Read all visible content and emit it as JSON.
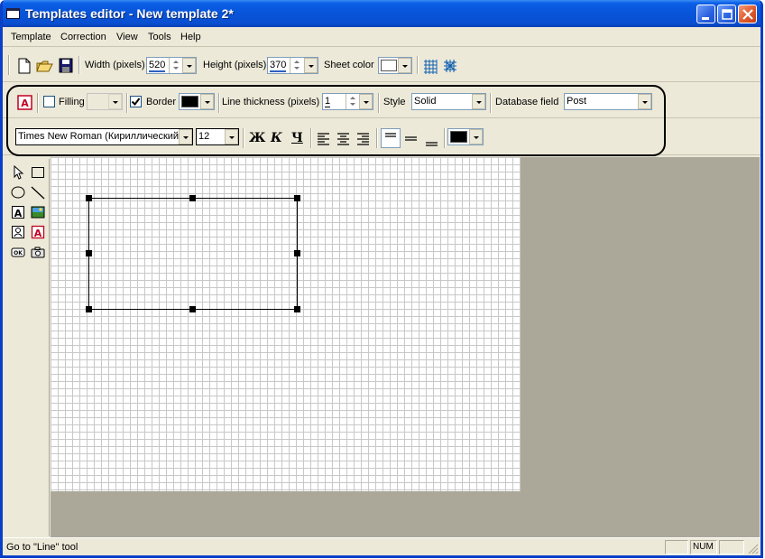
{
  "window": {
    "title": "Templates editor - New template 2*"
  },
  "menu": [
    "Template",
    "Correction",
    "View",
    "Tools",
    "Help"
  ],
  "toolbar1": {
    "width_label": "Width (pixels)",
    "width_value": "520",
    "height_label": "Height (pixels)",
    "height_value": "370",
    "sheet_color_label": "Sheet color",
    "sheet_color": "#ffffff"
  },
  "toolbar2": {
    "filling_label": "Filling",
    "filling_checked": false,
    "border_label": "Border",
    "border_checked": true,
    "border_color": "#000000",
    "line_thickness_label": "Line thickness (pixels)",
    "line_thickness_value": "1",
    "style_label": "Style",
    "style_value": "Solid",
    "db_field_label": "Database field",
    "db_field_value": "Post"
  },
  "toolbar3": {
    "font_value": "Times New Roman (Кириллический)",
    "size_value": "12",
    "bold_label": "Ж",
    "italic_label": "К",
    "underline_label": "Ч",
    "text_color": "#000000"
  },
  "status": {
    "message": "Go to \"Line\" tool",
    "num": "NUM"
  },
  "colors": {
    "accent": "#0a3fc8",
    "face": "#ece9d8",
    "workspace": "#aca899"
  }
}
